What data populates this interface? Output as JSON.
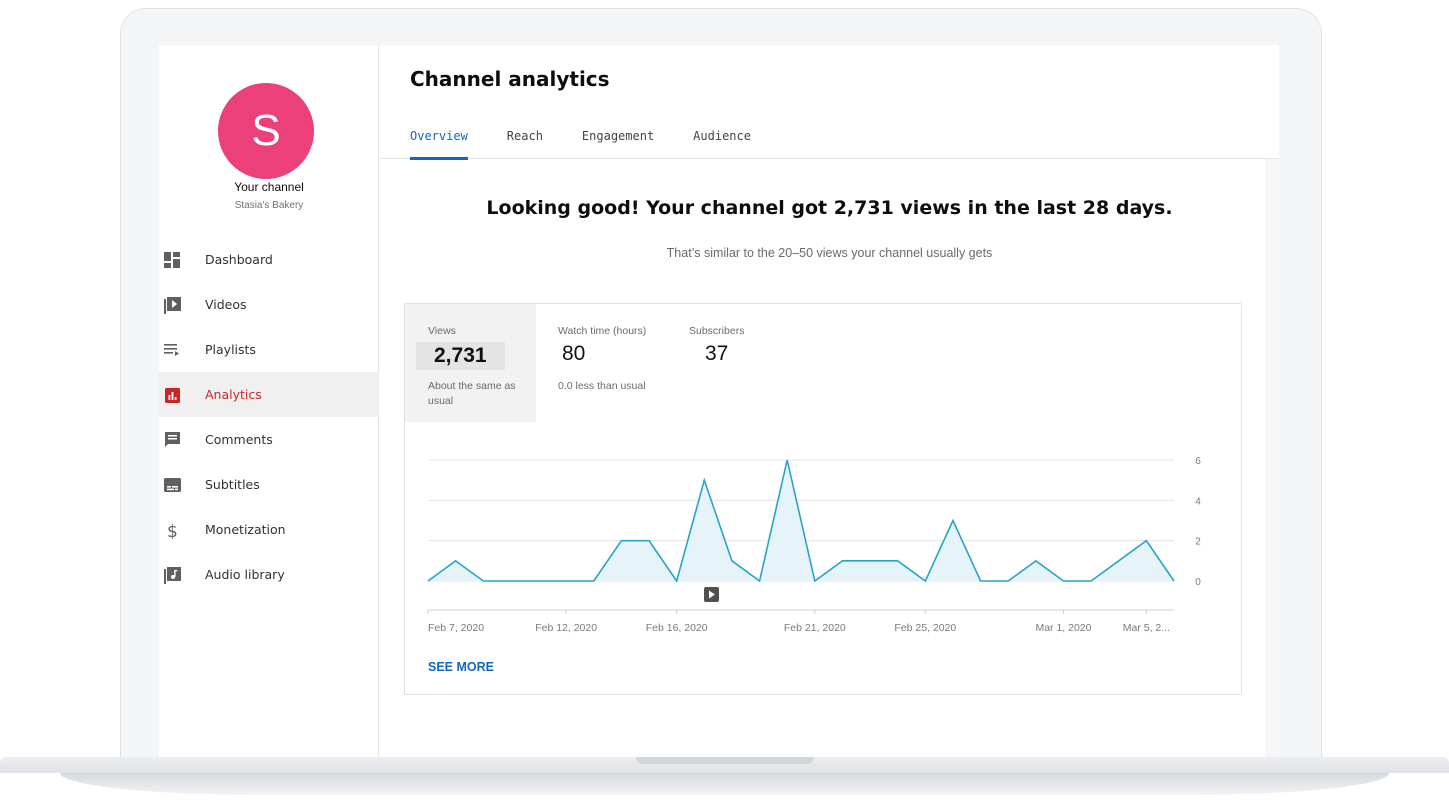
{
  "sidebar": {
    "avatar_letter": "S",
    "channel_name": "Your channel",
    "channel_sub": "Stasia's Bakery",
    "items": [
      {
        "label": "Dashboard",
        "icon": "dashboard-icon"
      },
      {
        "label": "Videos",
        "icon": "videos-icon"
      },
      {
        "label": "Playlists",
        "icon": "playlists-icon"
      },
      {
        "label": "Analytics",
        "icon": "analytics-icon",
        "active": true
      },
      {
        "label": "Comments",
        "icon": "comments-icon"
      },
      {
        "label": "Subtitles",
        "icon": "subtitles-icon"
      },
      {
        "label": "Monetization",
        "icon": "dollar-icon"
      },
      {
        "label": "Audio library",
        "icon": "audio-library-icon"
      }
    ]
  },
  "header": {
    "title": "Channel analytics",
    "tabs": [
      "Overview",
      "Reach",
      "Engagement",
      "Audience"
    ],
    "active_tab": "Overview"
  },
  "summary": {
    "headline": "Looking good! Your channel got 2,731 views in the last 28 days.",
    "subline": "That’s similar to the 20–50 views your channel usually gets"
  },
  "metrics": [
    {
      "label": "Views",
      "value": "2,731",
      "note": "About the same as usual"
    },
    {
      "label": "Watch time (hours)",
      "value": "80",
      "note": "0.0 less than usual"
    },
    {
      "label": "Subscribers",
      "value": "37",
      "note": ""
    }
  ],
  "see_more": "SEE MORE",
  "colors": {
    "accent": "#1565c0",
    "active_nav": "#c62828",
    "avatar": "#ec407a",
    "line": "#29a3c7",
    "area": "#e6f4f9"
  },
  "chart_data": {
    "type": "area",
    "x": [
      "Feb 7, 2020",
      "Feb 8, 2020",
      "Feb 9, 2020",
      "Feb 10, 2020",
      "Feb 11, 2020",
      "Feb 12, 2020",
      "Feb 13, 2020",
      "Feb 14, 2020",
      "Feb 15, 2020",
      "Feb 16, 2020",
      "Feb 17, 2020",
      "Feb 18, 2020",
      "Feb 19, 2020",
      "Feb 20, 2020",
      "Feb 21, 2020",
      "Feb 22, 2020",
      "Feb 23, 2020",
      "Feb 24, 2020",
      "Feb 25, 2020",
      "Feb 26, 2020",
      "Feb 27, 2020",
      "Feb 28, 2020",
      "Feb 29, 2020",
      "Mar 1, 2020",
      "Mar 2, 2020",
      "Mar 3, 2020",
      "Mar 4, 2020",
      "Mar 5, 2020"
    ],
    "values": [
      0,
      1,
      0,
      0,
      0,
      0,
      0,
      2,
      2,
      0,
      5,
      1,
      0,
      6,
      0,
      1,
      1,
      1,
      0,
      3,
      0,
      0,
      1,
      0,
      0,
      1,
      2,
      0
    ],
    "x_tick_labels": [
      "Feb 7, 2020",
      "Feb 12, 2020",
      "Feb 16, 2020",
      "Feb 21, 2020",
      "Feb 25, 2020",
      "Mar 1, 2020",
      "Mar 5, 2..."
    ],
    "x_tick_indices": [
      0,
      5,
      9,
      14,
      18,
      23,
      26
    ],
    "y_ticks": [
      0,
      2,
      4,
      6
    ],
    "ylim": [
      0,
      6
    ],
    "grid": true,
    "y_axis_side": "right",
    "marker_icon": "play-icon"
  }
}
